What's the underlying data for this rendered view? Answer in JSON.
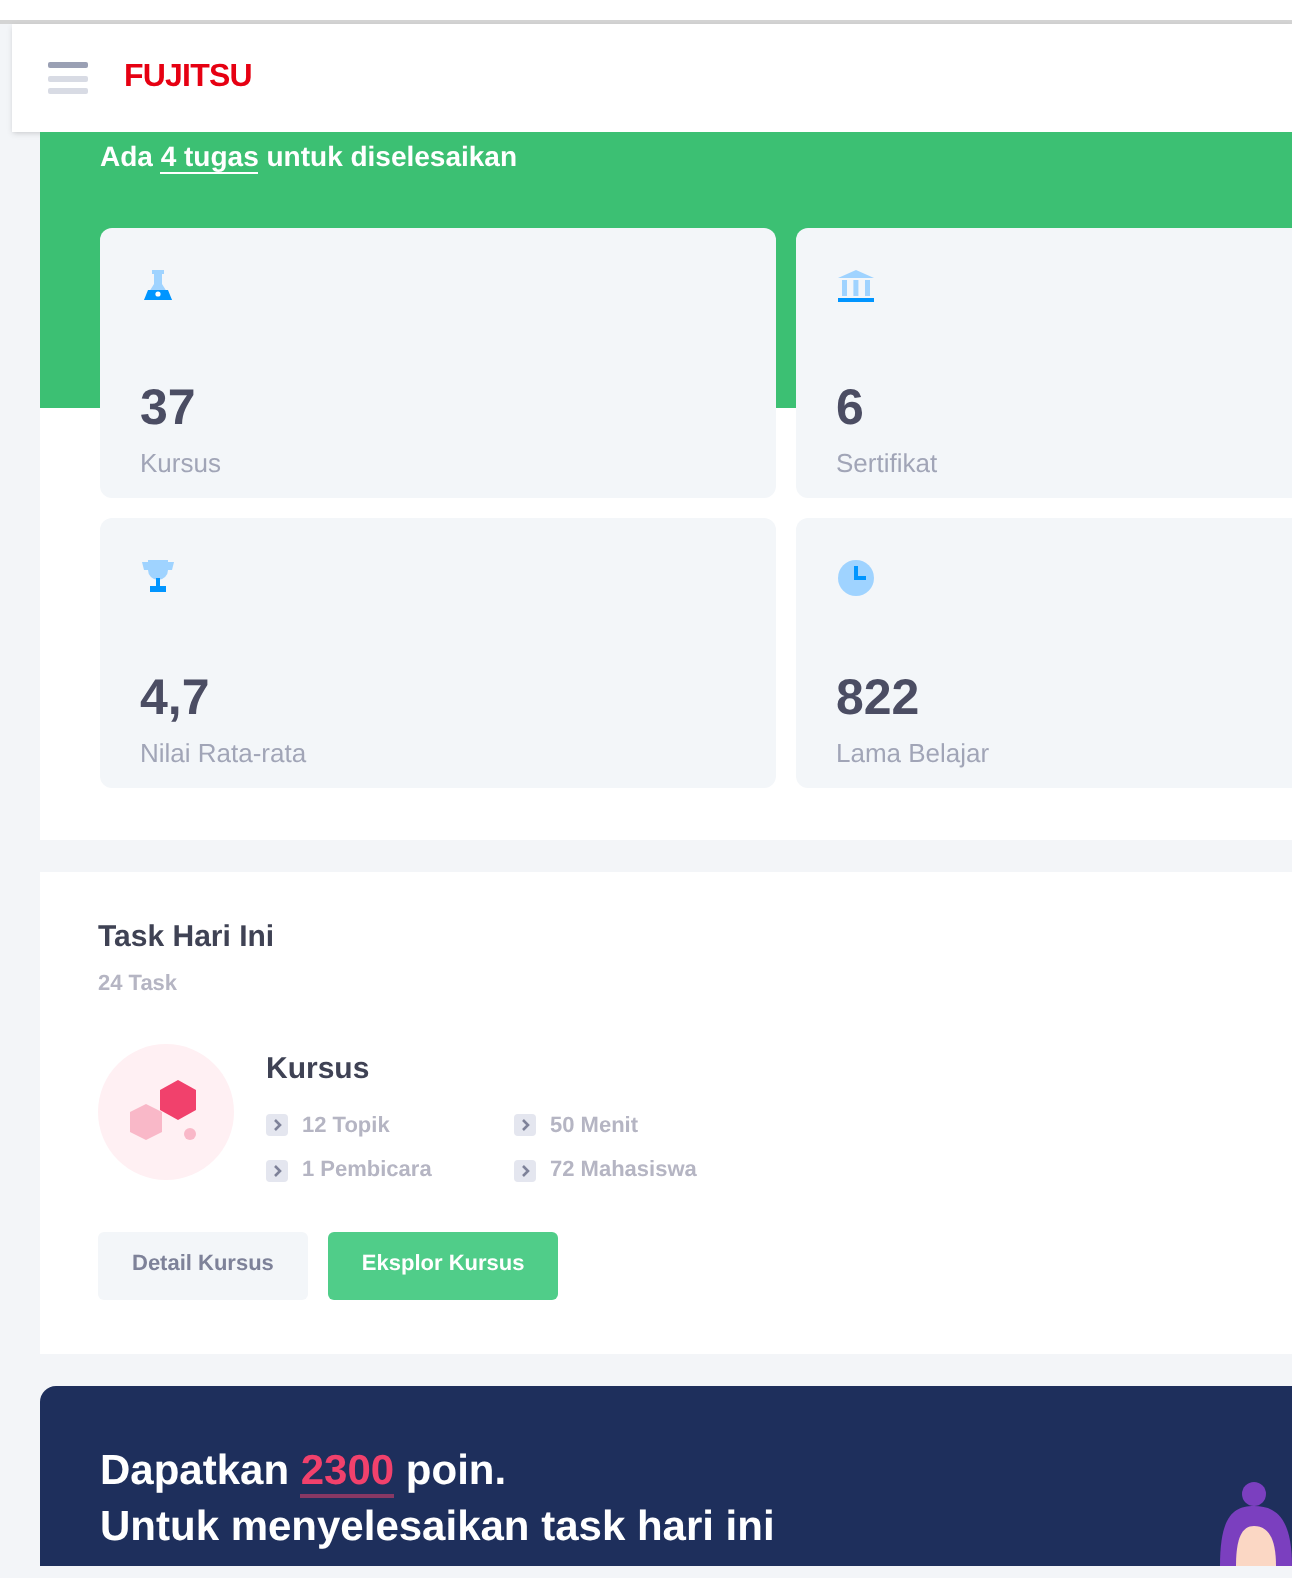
{
  "header": {
    "logo": "FUJITSU"
  },
  "banner": {
    "before": "Ada ",
    "highlight": "4 tugas",
    "after": " untuk diselesaikan"
  },
  "stats": [
    {
      "kind": "flask",
      "value": "37",
      "label": "Kursus"
    },
    {
      "kind": "bank",
      "value": "6",
      "label": "Sertifikat"
    },
    {
      "kind": "trophy",
      "value": "4,7",
      "label": "Nilai Rata-rata"
    },
    {
      "kind": "clock",
      "value": "822",
      "label": "Lama Belajar"
    }
  ],
  "task": {
    "title": "Task Hari Ini",
    "count": "24 Task",
    "course_title": "Kursus",
    "details": [
      "12 Topik",
      "50 Menit",
      "1 Pembicara",
      "72 Mahasiswa"
    ],
    "buttons": [
      {
        "label": "Detail Kursus",
        "kind": "secondary"
      },
      {
        "label": "Eksplor Kursus",
        "kind": "primary"
      }
    ]
  },
  "promo": {
    "line1": "Dapatkan **2300** poin.",
    "line2": "Untuk menyelesaikan task hari ini"
  }
}
